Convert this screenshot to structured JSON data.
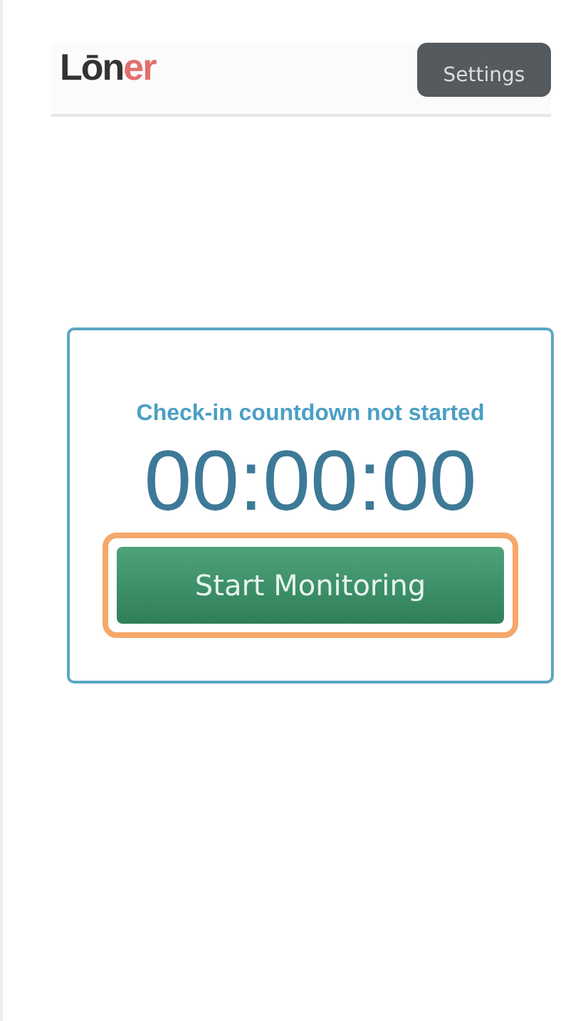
{
  "header": {
    "logo": {
      "main": "Lōn",
      "accent": "er"
    },
    "settings_button": "Settings"
  },
  "checkin": {
    "status": "Check-in countdown not started",
    "countdown": "00:00:00",
    "start_button": {
      "label": "Start Monitoring",
      "focused": true
    }
  }
}
